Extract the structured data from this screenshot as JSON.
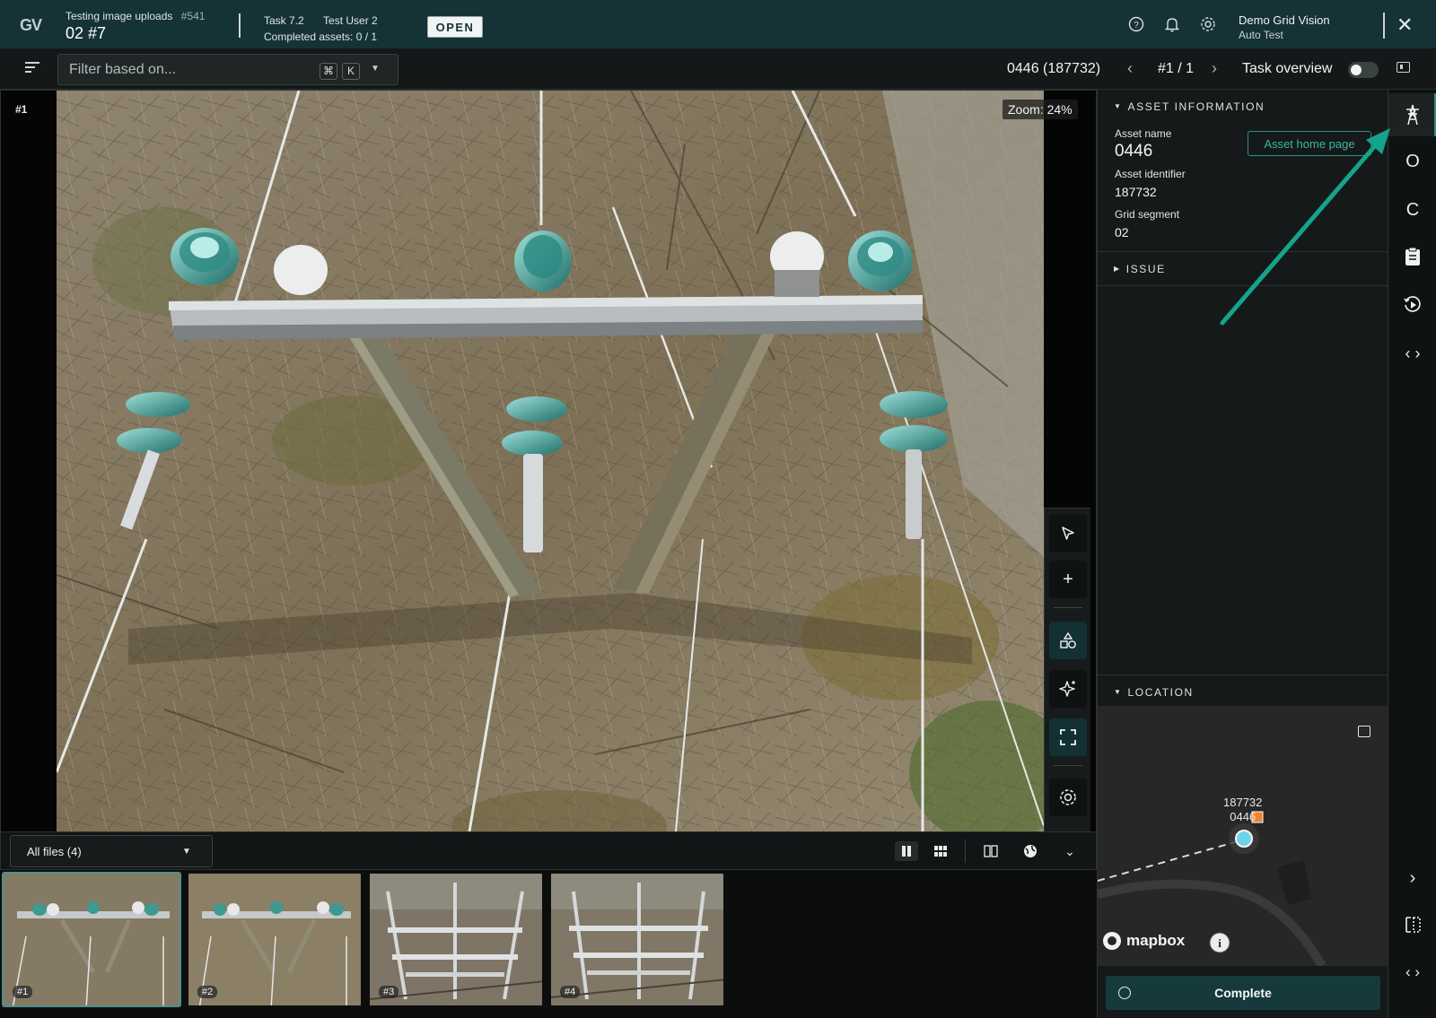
{
  "header": {
    "logo": "GV",
    "project_title": "Testing image uploads",
    "project_number": "#541",
    "project_subtitle": "02 #7",
    "task_label": "Task 7.2",
    "task_user": "Test User 2",
    "completed_assets": "Completed assets: 0 / 1",
    "status_badge": "OPEN",
    "user_name": "Demo Grid Vision",
    "user_sub": "Auto Test"
  },
  "toolbar2": {
    "filter_placeholder": "Filter based on...",
    "shortcut_key1": "⌘",
    "shortcut_key2": "K",
    "asset_id": "0446 (187732)",
    "counter": "#1 / 1",
    "task_overview": "Task overview"
  },
  "viewer": {
    "photo_index": "#1",
    "zoom": "Zoom: 24%"
  },
  "filebar": {
    "files_select": "All files (4)"
  },
  "thumbnails": [
    {
      "label": "#1"
    },
    {
      "label": "#2"
    },
    {
      "label": "#3"
    },
    {
      "label": "#4"
    }
  ],
  "asset_info": {
    "section_title": "ASSET INFORMATION",
    "name_label": "Asset name",
    "name_value": "0446",
    "identifier_label": "Asset identifier",
    "identifier_value": "187732",
    "segment_label": "Grid segment",
    "segment_value": "02",
    "home_button": "Asset home page"
  },
  "issue": {
    "section_title": "ISSUE"
  },
  "location": {
    "section_title": "LOCATION",
    "map_id": "187732",
    "map_name": "0446",
    "map_brand": "mapbox"
  },
  "complete_button": "Complete",
  "rail": {
    "item_o": "O",
    "item_c": "C"
  },
  "colors": {
    "header_bg": "#153236",
    "accent": "#2e8f86",
    "annotation_arrow": "#14a38b"
  }
}
